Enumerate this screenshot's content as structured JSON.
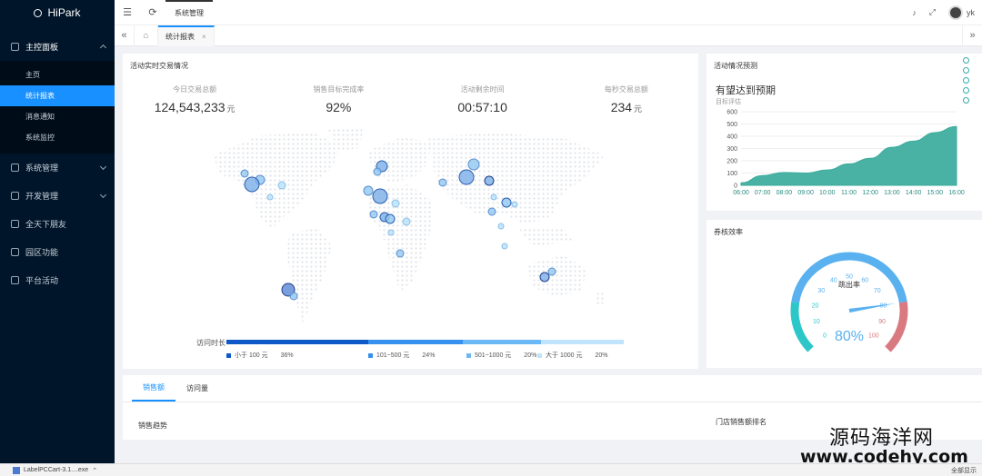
{
  "app": {
    "name": "HiPark"
  },
  "sidebar": {
    "groups": [
      {
        "label": "主控面板",
        "open": true
      },
      {
        "label": "系统管理"
      },
      {
        "label": "开发管理"
      },
      {
        "label": "全天下朋友"
      },
      {
        "label": "园区功能"
      },
      {
        "label": "平台活动"
      }
    ],
    "subitems": [
      "主页",
      "统计报表",
      "消息通知",
      "系统监控"
    ]
  },
  "topbar": {
    "tab": "系统管理",
    "user": "yk"
  },
  "tabbar": {
    "page_tab": "统计报表",
    "close": "×"
  },
  "map_card": {
    "title": "活动实时交易情况",
    "stats": [
      {
        "label": "今日交易总额",
        "value": "124,543,233",
        "unit": "元"
      },
      {
        "label": "销售目标完成率",
        "value": "92%",
        "unit": ""
      },
      {
        "label": "活动剩余时间",
        "value": "00:57:10",
        "unit": ""
      },
      {
        "label": "每秒交易总额",
        "value": "234",
        "unit": "元"
      }
    ],
    "legend_title": "访问时长",
    "legend": [
      {
        "label": "小于 100 元",
        "pct": "36%",
        "color": "#0f58c8"
      },
      {
        "label": "101~500 元",
        "pct": "24%",
        "color": "#3590ee"
      },
      {
        "label": "501~1000 元",
        "pct": "20%",
        "color": "#6bb8f6"
      },
      {
        "label": "大于 1000 元",
        "pct": "20%",
        "color": "#bfe4fb"
      }
    ]
  },
  "trend_card": {
    "title": "活动情况预测",
    "headline": "有望达到预期",
    "subtitle": "目标评估"
  },
  "chart_data": {
    "type": "area",
    "x": [
      "06:00",
      "07:00",
      "08:00",
      "09:00",
      "10:00",
      "11:00",
      "12:00",
      "13:00",
      "14:00",
      "15:00",
      "16:00"
    ],
    "values": [
      20,
      80,
      105,
      100,
      125,
      175,
      220,
      310,
      360,
      430,
      480
    ],
    "ylim": [
      0,
      600
    ],
    "yticks": [
      "0",
      "100",
      "200",
      "300",
      "400",
      "500",
      "600"
    ],
    "color": "#3bab9c"
  },
  "gauge_card": {
    "title": "券核效率",
    "label": "跳出率",
    "value": 80,
    "value_text": "80%",
    "ticks": [
      "0",
      "10",
      "20",
      "30",
      "40",
      "50",
      "60",
      "70",
      "80",
      "90",
      "100"
    ]
  },
  "bottom_card": {
    "tabs": [
      "销售额",
      "访问量"
    ],
    "left_title": "销售趋势",
    "right_title": "门店销售额排名"
  },
  "watermark": {
    "line1": "源码海洋网",
    "line2": "www.codehy.com"
  },
  "taskbar": {
    "item": "LabelPCCart-3.1....exe",
    "right": "全部显示"
  }
}
